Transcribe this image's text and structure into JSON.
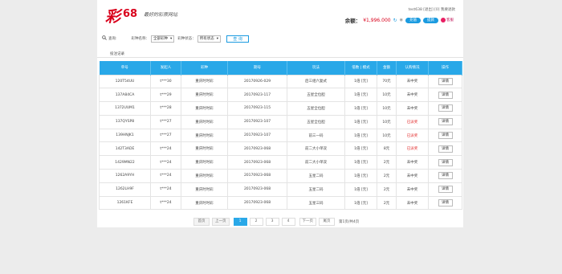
{
  "brand": {
    "logo_char": "彩",
    "logo_num": "68",
    "slogan": "最好的彩票网站"
  },
  "header": {
    "user_line": "test638 [退出] [0] 我要退款",
    "balance_label": "余额：",
    "balance_value": "¥1,996.000",
    "recharge_label": "充值",
    "withdraw_label": "提款",
    "service_label": "客服"
  },
  "filter": {
    "search_label": "查询:",
    "lottery_label": "彩种名称：",
    "lottery_value": "全部彩种",
    "status_label": "彩种状态：",
    "status_value": "所有状态",
    "query_button": "查 询"
  },
  "section_title": "投注记录",
  "table": {
    "headers": [
      "单号",
      "发起人",
      "彩种",
      "期号",
      "玩法",
      "倍数 | 模式",
      "金额",
      "认购情况",
      "操作"
    ],
    "rows": [
      [
        "120T54UU",
        "t***30",
        "重庆时时彩",
        "20170926-029",
        "后三组六复式",
        "1倍 [元]",
        "70元",
        "未中奖",
        "详情"
      ],
      [
        "137A84CA",
        "t***29",
        "重庆时时彩",
        "20170923-117",
        "五星全位胆",
        "1倍 [元]",
        "10元",
        "未中奖",
        "详情"
      ],
      [
        "1372UUM1",
        "t***28",
        "重庆时时彩",
        "20170923-115",
        "五星全位胆",
        "1倍 [元]",
        "10元",
        "未中奖",
        "详情"
      ],
      [
        "137QYSP8",
        "t***27",
        "重庆时时彩",
        "20170923-107",
        "五星全位胆",
        "1倍 [元]",
        "10元",
        "已派奖",
        "详情"
      ],
      [
        "139HNJK1",
        "t***27",
        "重庆时时彩",
        "20170923-107",
        "前三一码",
        "1倍 [元]",
        "10元",
        "已派奖",
        "详情"
      ],
      [
        "142T3ADE",
        "t***24",
        "重庆时时彩",
        "20170923-068",
        "前二大小单双",
        "1倍 [元]",
        "8元",
        "已派奖",
        "详情"
      ],
      [
        "1429MN22",
        "t***24",
        "重庆时时彩",
        "20170923-068",
        "前二大小单双",
        "1倍 [元]",
        "2元",
        "未中奖",
        "详情"
      ],
      [
        "1262A9YH",
        "t***24",
        "重庆时时彩",
        "20170923-068",
        "五星二码",
        "1倍 [元]",
        "2元",
        "未中奖",
        "详情"
      ],
      [
        "1262LH9F",
        "t***24",
        "重庆时时彩",
        "20170923-068",
        "五星二码",
        "1倍 [元]",
        "2元",
        "未中奖",
        "详情"
      ],
      [
        "1261KFE",
        "t***24",
        "重庆时时彩",
        "20170923-068",
        "五星三码",
        "1倍 [元]",
        "2元",
        "未中奖",
        "详情"
      ]
    ],
    "status_colors": {
      "已派奖": "#e02020",
      "未中奖": "#444444"
    }
  },
  "pagination": {
    "first": "首页",
    "prev": "上一页",
    "pages": [
      "1",
      "2",
      "3",
      "4"
    ],
    "current": "1",
    "next": "下一页",
    "last": "尾页",
    "info": "第1页/共4页"
  },
  "colors": {
    "accent": "#29a8e8",
    "brand_red": "#d9001b"
  }
}
